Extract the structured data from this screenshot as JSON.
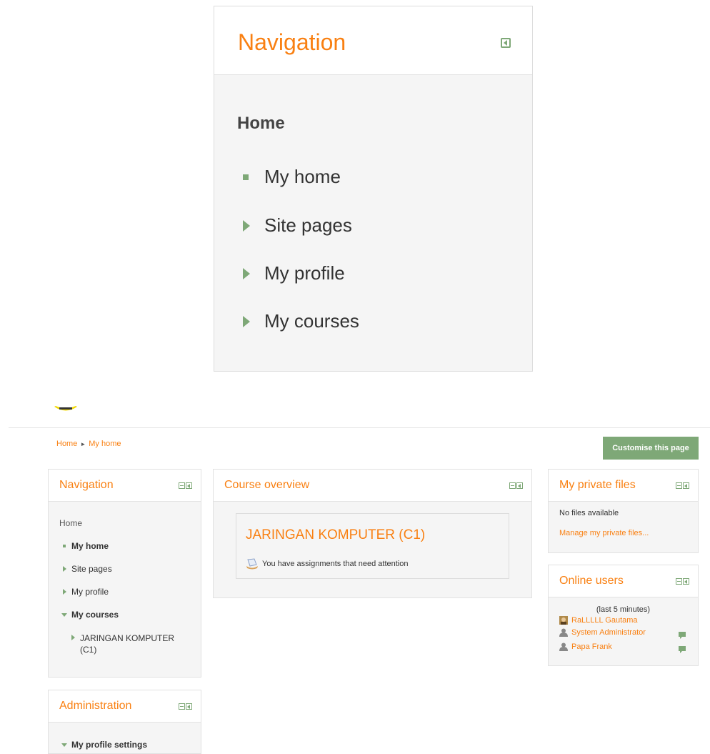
{
  "zoom": {
    "title": "Navigation",
    "home": "Home",
    "items": [
      "My home",
      "Site pages",
      "My profile",
      "My courses"
    ]
  },
  "breadcrumb": {
    "home": "Home",
    "sep": "►",
    "current": "My home"
  },
  "customise_button": "Customise this page",
  "navigation": {
    "title": "Navigation",
    "home": "Home",
    "my_home": "My home",
    "site_pages": "Site pages",
    "my_profile": "My profile",
    "my_courses": "My courses",
    "course_line1": "JARINGAN KOMPUTER",
    "course_line2": "(C1)"
  },
  "administration": {
    "title": "Administration",
    "item": "My profile settings"
  },
  "course_overview": {
    "title": "Course overview",
    "course": "JARINGAN KOMPUTER (C1)",
    "notice": "You have assignments that need attention"
  },
  "private_files": {
    "title": "My private files",
    "empty": "No files available",
    "manage": "Manage my private files..."
  },
  "online_users": {
    "title": "Online users",
    "period": "(last 5 minutes)",
    "users": [
      "RaLLLLL Gautama",
      "System Administrator",
      "Papa Frank"
    ]
  },
  "colors": {
    "accent": "#f98012",
    "green": "#7ea877"
  }
}
